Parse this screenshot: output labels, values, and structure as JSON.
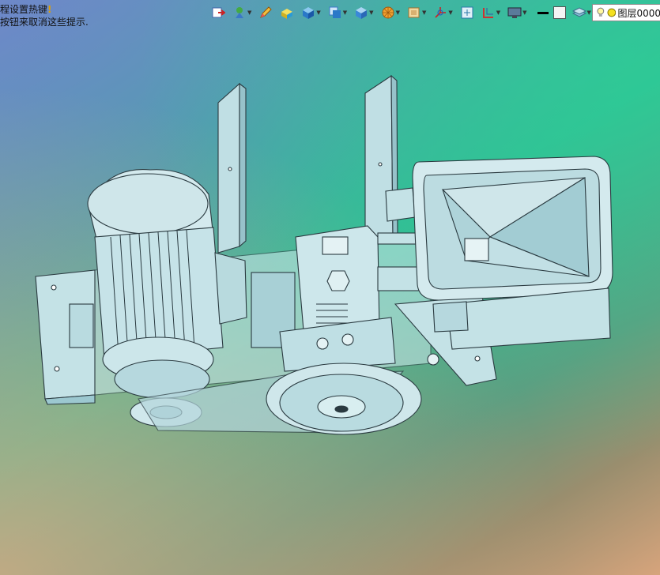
{
  "hint": {
    "line1": "程设置热键",
    "line2": "按钮来取消这些提示."
  },
  "toolbar": {
    "items": [
      {
        "name": "exit-sketch-icon"
      },
      {
        "name": "display-style-icon",
        "dropdown": true
      },
      {
        "name": "edit-pencil-icon"
      },
      {
        "name": "solid-yellow-icon"
      },
      {
        "name": "solid-blue-icon",
        "dropdown": true
      },
      {
        "name": "view-orient-icon",
        "dropdown": true
      },
      {
        "name": "isometric-view-icon",
        "dropdown": true
      },
      {
        "name": "render-sphere-icon",
        "dropdown": true
      },
      {
        "name": "shaded-box-icon",
        "dropdown": true
      },
      {
        "name": "axis-triad-icon",
        "dropdown": true
      },
      {
        "name": "zoom-fit-icon"
      },
      {
        "name": "section-view-icon",
        "dropdown": true
      },
      {
        "name": "monitor-icon",
        "dropdown": true
      }
    ],
    "line_color": "#000000",
    "fill_color": "#f4f4f4"
  },
  "layer": {
    "label": "图层0000"
  },
  "colors": {
    "model_fill": "#c9e6ea",
    "model_shade": "#9cc8d0",
    "model_line": "#2a3a40"
  }
}
